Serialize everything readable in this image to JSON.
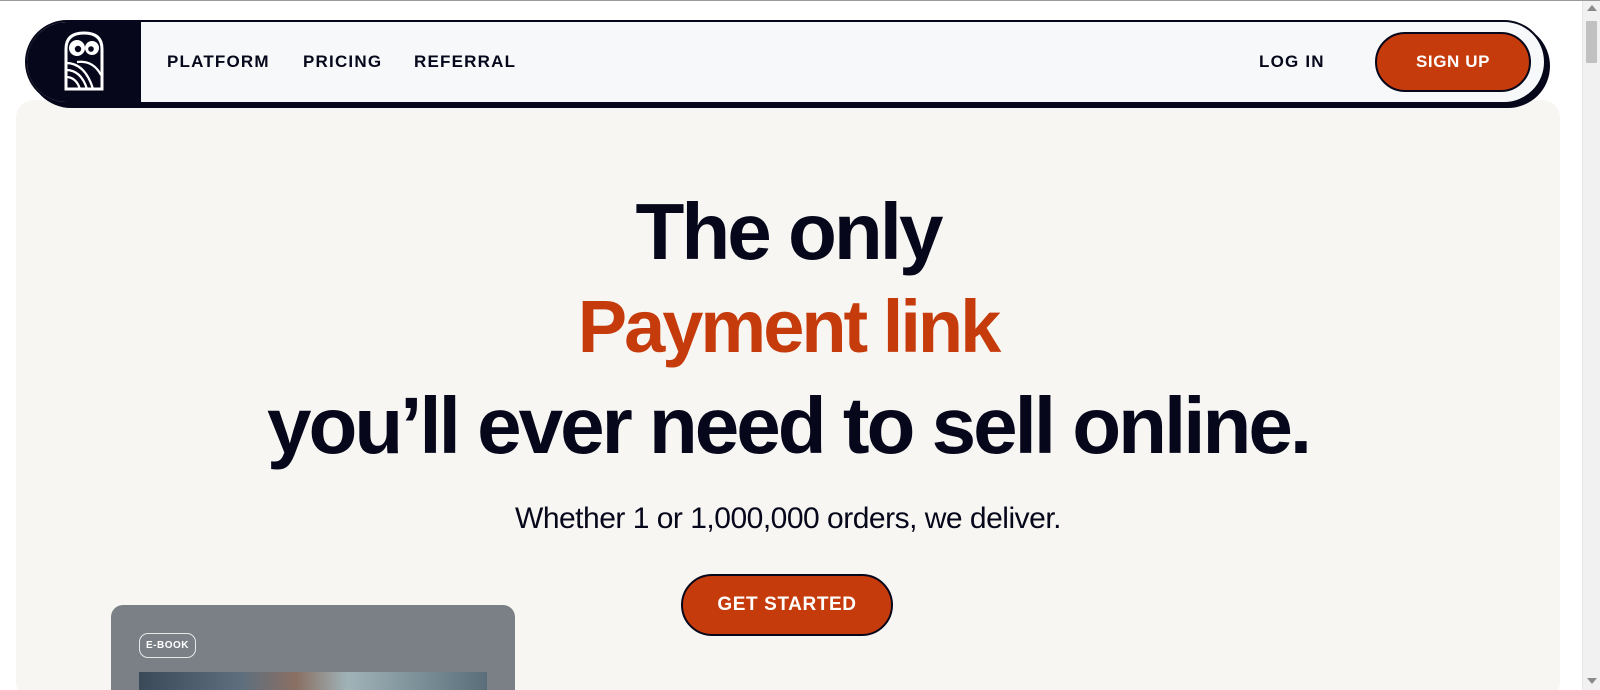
{
  "nav": {
    "logo_icon": "owl-logo-icon",
    "links": [
      "PLATFORM",
      "PRICING",
      "REFERRAL"
    ],
    "login": "LOG IN",
    "signup": "SIGN UP"
  },
  "hero": {
    "line1": "The only",
    "line2": "Payment link",
    "line3": "you’ll ever need to sell online.",
    "subtitle": "Whether 1 or 1,000,000 orders, we deliver.",
    "cta": "GET STARTED"
  },
  "card": {
    "badge": "E-BOOK"
  },
  "colors": {
    "accent": "#c63b0b",
    "navy": "#06071b",
    "background": "#f7f6f2"
  }
}
